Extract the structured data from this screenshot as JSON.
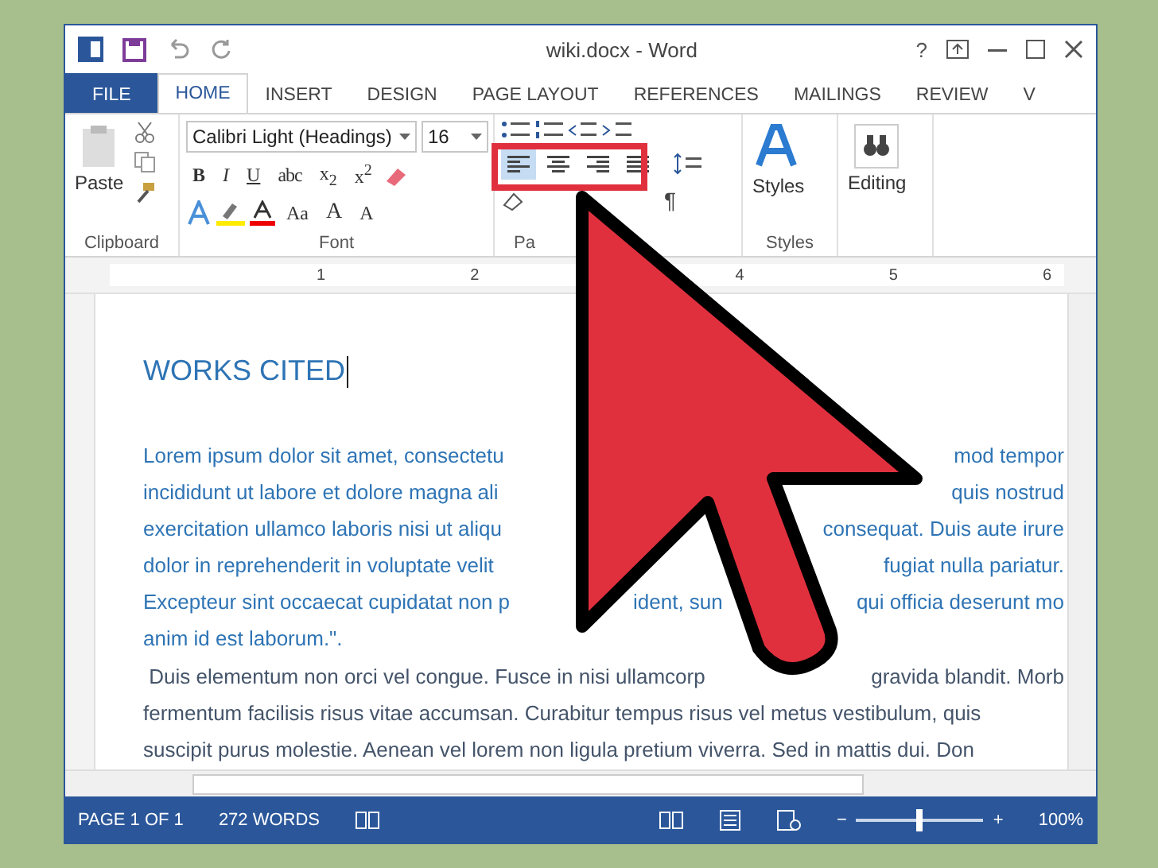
{
  "window": {
    "title": "wiki.docx - Word",
    "help": "?"
  },
  "tabs": [
    {
      "label": "FILE",
      "kind": "file",
      "selected": false
    },
    {
      "label": "HOME",
      "kind": "tab",
      "selected": true
    },
    {
      "label": "INSERT",
      "kind": "tab",
      "selected": false
    },
    {
      "label": "DESIGN",
      "kind": "tab",
      "selected": false
    },
    {
      "label": "PAGE LAYOUT",
      "kind": "tab",
      "selected": false
    },
    {
      "label": "REFERENCES",
      "kind": "tab",
      "selected": false
    },
    {
      "label": "MAILINGS",
      "kind": "tab",
      "selected": false
    },
    {
      "label": "REVIEW",
      "kind": "tab",
      "selected": false
    },
    {
      "label": "V",
      "kind": "tab",
      "selected": false
    }
  ],
  "ribbon": {
    "paste": "Paste",
    "font_name": "Calibri Light (Headings)",
    "font_size": "16",
    "format_buttons": [
      {
        "label": "B",
        "kind": "bold"
      },
      {
        "label": "I",
        "kind": "italic"
      },
      {
        "label": "U",
        "kind": "underline"
      },
      {
        "label": "abc",
        "kind": "strike"
      },
      {
        "label": "x$_{2}$",
        "kind": "plain"
      },
      {
        "label": "x$^{2}$",
        "kind": "plain"
      }
    ],
    "case_button": "Aa",
    "grow_button": "A",
    "shrink_button": "A",
    "alignment": [
      {
        "kind": "left",
        "selected": true
      },
      {
        "kind": "center",
        "selected": false
      },
      {
        "kind": "right",
        "selected": false
      },
      {
        "kind": "justify",
        "selected": false
      }
    ],
    "pilcrow": "¶",
    "styles": "Styles",
    "editing": "Editing",
    "groups": [
      "Clipboard",
      "Font",
      "Pa",
      "Styles"
    ]
  },
  "ruler": [
    "1",
    "2",
    "4",
    "5",
    "6"
  ],
  "document": {
    "heading": "WORKS CITED",
    "paragraphs": [
      {
        "kind": "blue",
        "lines": [
          [
            "Lorem ipsum dolor sit amet, consectetu",
            "mod tempor"
          ],
          [
            "incididunt ut labore et dolore magna ali",
            "quis nostrud"
          ],
          [
            "exercitation ullamco laboris nisi ut aliqu",
            "consequat. Duis aute irure"
          ],
          [
            "dolor in reprehenderit in voluptate velit",
            "fugiat nulla pariatur."
          ],
          [
            "Excepteur sint occaecat cupidatat non p",
            "ident, sun",
            "qui officia deserunt mo"
          ],
          [
            "anim id est laborum.\"."
          ]
        ]
      },
      {
        "kind": "dark",
        "lines": [
          [
            " Duis elementum non orci vel congue. Fusce in nisi ullamcorp",
            "gravida blandit. Morb"
          ],
          [
            "fermentum facilisis risus vitae accumsan. Curabitur tempus risus vel metus vestibulum, quis"
          ],
          [
            "suscipit purus molestie. Aenean vel lorem non ligula pretium viverra. Sed in mattis dui. Don"
          ]
        ]
      }
    ]
  },
  "status_bar": {
    "page": "PAGE 1 OF 1",
    "words": "272 WORDS",
    "zoom_out": "−",
    "zoom_in": "+",
    "zoom": "100%",
    "level": 0.5
  }
}
